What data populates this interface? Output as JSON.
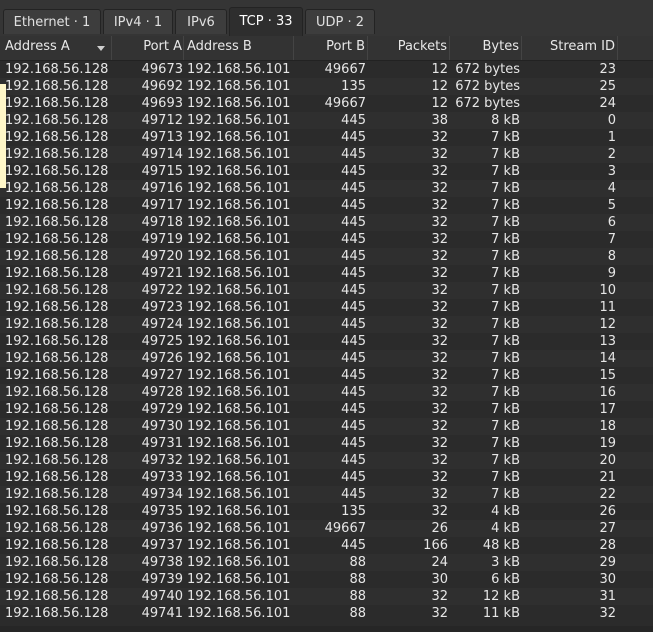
{
  "tabs": [
    {
      "label": "Ethernet · 1"
    },
    {
      "label": "IPv4 · 1"
    },
    {
      "label": "IPv6"
    },
    {
      "label": "TCP · 33",
      "active": true
    },
    {
      "label": "UDP · 2"
    }
  ],
  "columns": [
    "Address A",
    "Port A",
    "Address B",
    "Port B",
    "Packets",
    "Bytes",
    "Stream ID"
  ],
  "rows": [
    [
      "192.168.56.128",
      "49673",
      "192.168.56.101",
      "49667",
      "12",
      "672 bytes",
      "23"
    ],
    [
      "192.168.56.128",
      "49692",
      "192.168.56.101",
      "135",
      "12",
      "672 bytes",
      "25"
    ],
    [
      "192.168.56.128",
      "49693",
      "192.168.56.101",
      "49667",
      "12",
      "672 bytes",
      "24"
    ],
    [
      "192.168.56.128",
      "49712",
      "192.168.56.101",
      "445",
      "38",
      "8 kB",
      "0"
    ],
    [
      "192.168.56.128",
      "49713",
      "192.168.56.101",
      "445",
      "32",
      "7 kB",
      "1"
    ],
    [
      "192.168.56.128",
      "49714",
      "192.168.56.101",
      "445",
      "32",
      "7 kB",
      "2"
    ],
    [
      "192.168.56.128",
      "49715",
      "192.168.56.101",
      "445",
      "32",
      "7 kB",
      "3"
    ],
    [
      "192.168.56.128",
      "49716",
      "192.168.56.101",
      "445",
      "32",
      "7 kB",
      "4"
    ],
    [
      "192.168.56.128",
      "49717",
      "192.168.56.101",
      "445",
      "32",
      "7 kB",
      "5"
    ],
    [
      "192.168.56.128",
      "49718",
      "192.168.56.101",
      "445",
      "32",
      "7 kB",
      "6"
    ],
    [
      "192.168.56.128",
      "49719",
      "192.168.56.101",
      "445",
      "32",
      "7 kB",
      "7"
    ],
    [
      "192.168.56.128",
      "49720",
      "192.168.56.101",
      "445",
      "32",
      "7 kB",
      "8"
    ],
    [
      "192.168.56.128",
      "49721",
      "192.168.56.101",
      "445",
      "32",
      "7 kB",
      "9"
    ],
    [
      "192.168.56.128",
      "49722",
      "192.168.56.101",
      "445",
      "32",
      "7 kB",
      "10"
    ],
    [
      "192.168.56.128",
      "49723",
      "192.168.56.101",
      "445",
      "32",
      "7 kB",
      "11"
    ],
    [
      "192.168.56.128",
      "49724",
      "192.168.56.101",
      "445",
      "32",
      "7 kB",
      "12"
    ],
    [
      "192.168.56.128",
      "49725",
      "192.168.56.101",
      "445",
      "32",
      "7 kB",
      "13"
    ],
    [
      "192.168.56.128",
      "49726",
      "192.168.56.101",
      "445",
      "32",
      "7 kB",
      "14"
    ],
    [
      "192.168.56.128",
      "49727",
      "192.168.56.101",
      "445",
      "32",
      "7 kB",
      "15"
    ],
    [
      "192.168.56.128",
      "49728",
      "192.168.56.101",
      "445",
      "32",
      "7 kB",
      "16"
    ],
    [
      "192.168.56.128",
      "49729",
      "192.168.56.101",
      "445",
      "32",
      "7 kB",
      "17"
    ],
    [
      "192.168.56.128",
      "49730",
      "192.168.56.101",
      "445",
      "32",
      "7 kB",
      "18"
    ],
    [
      "192.168.56.128",
      "49731",
      "192.168.56.101",
      "445",
      "32",
      "7 kB",
      "19"
    ],
    [
      "192.168.56.128",
      "49732",
      "192.168.56.101",
      "445",
      "32",
      "7 kB",
      "20"
    ],
    [
      "192.168.56.128",
      "49733",
      "192.168.56.101",
      "445",
      "32",
      "7 kB",
      "21"
    ],
    [
      "192.168.56.128",
      "49734",
      "192.168.56.101",
      "445",
      "32",
      "7 kB",
      "22"
    ],
    [
      "192.168.56.128",
      "49735",
      "192.168.56.101",
      "135",
      "32",
      "4 kB",
      "26"
    ],
    [
      "192.168.56.128",
      "49736",
      "192.168.56.101",
      "49667",
      "26",
      "4 kB",
      "27"
    ],
    [
      "192.168.56.128",
      "49737",
      "192.168.56.101",
      "445",
      "166",
      "48 kB",
      "28"
    ],
    [
      "192.168.56.128",
      "49738",
      "192.168.56.101",
      "88",
      "24",
      "3 kB",
      "29"
    ],
    [
      "192.168.56.128",
      "49739",
      "192.168.56.101",
      "88",
      "30",
      "6 kB",
      "30"
    ],
    [
      "192.168.56.128",
      "49740",
      "192.168.56.101",
      "88",
      "32",
      "12 kB",
      "31"
    ],
    [
      "192.168.56.128",
      "49741",
      "192.168.56.101",
      "88",
      "32",
      "11 kB",
      "32"
    ]
  ],
  "sort": {
    "column": "Address A",
    "icon": "chevron-down-icon"
  }
}
